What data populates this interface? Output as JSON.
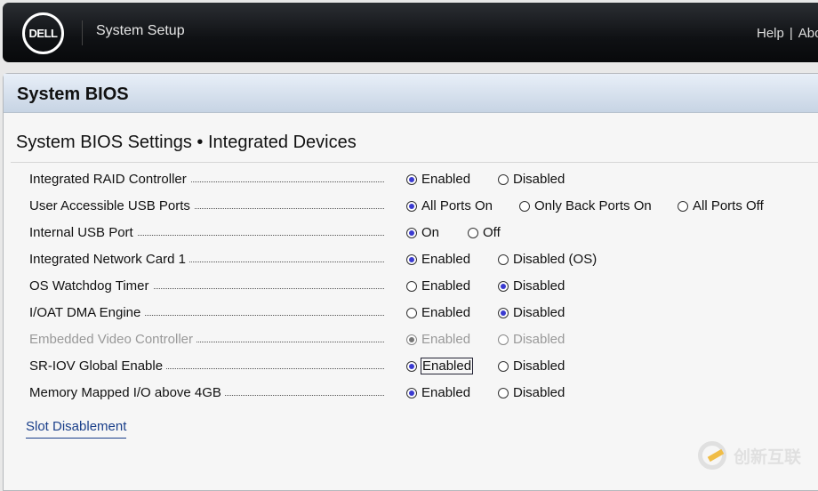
{
  "header": {
    "logo": "DELL",
    "title": "System Setup",
    "nav": [
      "Help",
      "|",
      "About"
    ]
  },
  "panel": {
    "title": "System BIOS",
    "subtitle": "System BIOS Settings • Integrated Devices"
  },
  "settings": [
    {
      "label": "Integrated RAID Controller",
      "options": [
        "Enabled",
        "Disabled"
      ],
      "selected": 0
    },
    {
      "label": "User Accessible USB Ports",
      "options": [
        "All Ports On",
        "Only Back Ports On",
        "All Ports Off"
      ],
      "selected": 0
    },
    {
      "label": "Internal USB Port",
      "options": [
        "On",
        "Off"
      ],
      "selected": 0
    },
    {
      "label": "Integrated Network Card 1",
      "options": [
        "Enabled",
        "Disabled (OS)"
      ],
      "selected": 0
    },
    {
      "label": "OS Watchdog Timer",
      "options": [
        "Enabled",
        "Disabled"
      ],
      "selected": 1
    },
    {
      "label": "I/OAT DMA Engine",
      "options": [
        "Enabled",
        "Disabled"
      ],
      "selected": 1
    },
    {
      "label": "Embedded Video Controller",
      "options": [
        "Enabled",
        "Disabled"
      ],
      "selected": 0,
      "disabled": true
    },
    {
      "label": "SR-IOV Global Enable",
      "options": [
        "Enabled",
        "Disabled"
      ],
      "selected": 0,
      "focused": true
    },
    {
      "label": "Memory Mapped I/O above 4GB",
      "options": [
        "Enabled",
        "Disabled"
      ],
      "selected": 0
    }
  ],
  "link": "Slot Disablement",
  "watermark": "创新互联",
  "colors": {
    "accent": "#3a3ad0",
    "link": "#1a3f8a"
  }
}
